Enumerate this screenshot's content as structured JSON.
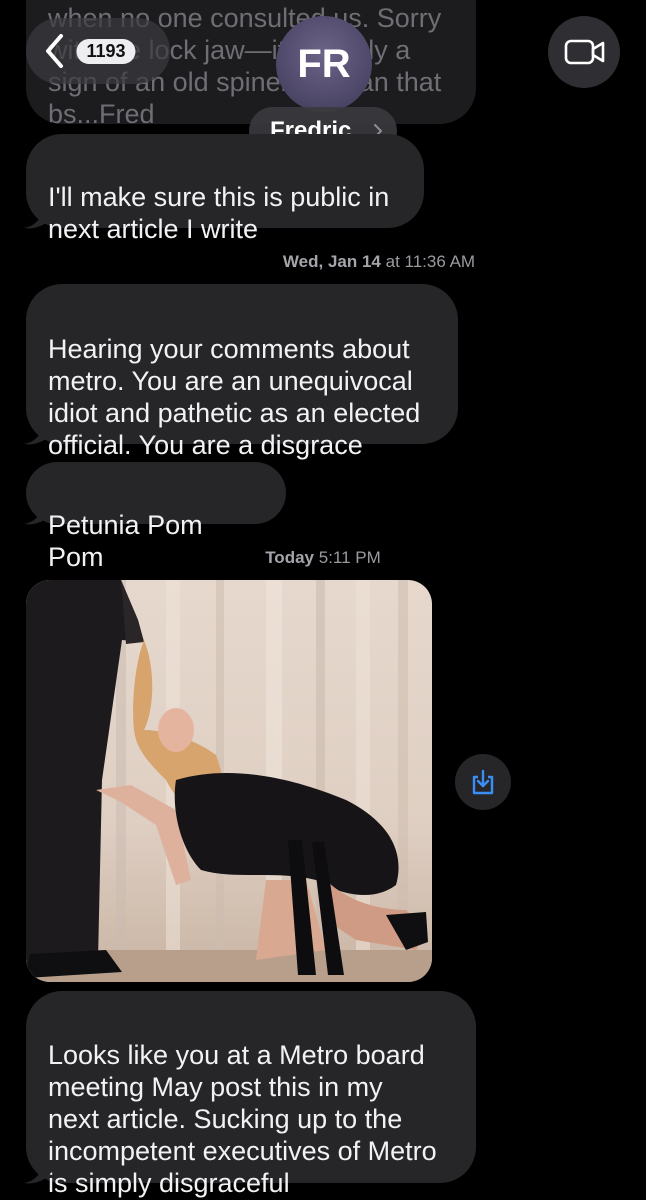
{
  "header": {
    "back_count": "1193",
    "contact_initials": "FR",
    "contact_name": "Fredric",
    "name_chevron": "›",
    "back_icon": "chevron-left-icon",
    "video_icon": "video-camera-icon"
  },
  "previous_message_fragment": "when no one consulted us. Sorry\nwith the lock jaw—it's simply a\nsign of an old spineless man that\nbs...Fred",
  "messages": [
    {
      "text": "I'll make sure this is public in\nnext article I write"
    },
    {
      "timestamp_day": "Wed, Jan 14",
      "timestamp_time": "at 11:36 AM"
    },
    {
      "text": "Hearing your comments about\nmetro. You are an unequivocal\nidiot and pathetic as an elected\nofficial. You are a disgrace"
    },
    {
      "text": "Petunia Pom Pom"
    },
    {
      "timestamp_day": "Today",
      "timestamp_time": "5:11 PM"
    },
    {
      "type": "image",
      "icon": "download-icon"
    },
    {
      "text": "Looks like you at a Metro board\nmeeting   May post this in my\nnext article. Sucking up to the\nincompetent executives of Metro\nis simply disgraceful"
    }
  ],
  "colors": {
    "background": "#000000",
    "bubble": "#262629",
    "timestamp": "#9a9aa0",
    "accent": "#3a8ff7"
  }
}
